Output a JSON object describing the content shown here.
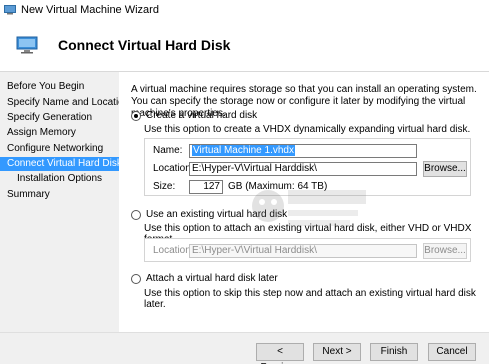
{
  "window": {
    "title": "New Virtual Machine Wizard"
  },
  "header": {
    "title": "Connect Virtual Hard Disk"
  },
  "sidebar": {
    "items": [
      {
        "label": "Before You Begin"
      },
      {
        "label": "Specify Name and Location"
      },
      {
        "label": "Specify Generation"
      },
      {
        "label": "Assign Memory"
      },
      {
        "label": "Configure Networking"
      },
      {
        "label": "Connect Virtual Hard Disk"
      },
      {
        "label": "Installation Options"
      },
      {
        "label": "Summary"
      }
    ]
  },
  "main": {
    "intro": "A virtual machine requires storage so that you can install an operating system. You can specify the storage now or configure it later by modifying the virtual machine's properties.",
    "create": {
      "radio_label": "Create a virtual hard disk",
      "description": "Use this option to create a VHDX dynamically expanding virtual hard disk.",
      "name_label": "Name:",
      "name_value": "Virtual Machine 1.vhdx",
      "location_label": "Location:",
      "location_value": "E:\\Hyper-V\\Virtual Harddisk\\",
      "browse_label": "Browse...",
      "size_label": "Size:",
      "size_value": "127",
      "size_unit": "GB (Maximum: 64 TB)"
    },
    "existing": {
      "radio_label": "Use an existing virtual hard disk",
      "description": "Use this option to attach an existing virtual hard disk, either VHD or VHDX format.",
      "location_label": "Location:",
      "location_value": "E:\\Hyper-V\\Virtual Harddisk\\",
      "browse_label": "Browse..."
    },
    "later": {
      "radio_label": "Attach a virtual hard disk later",
      "description": "Use this option to skip this step now and attach an existing virtual hard disk later."
    }
  },
  "footer": {
    "previous_label": "< Previous",
    "next_label": "Next >",
    "finish_label": "Finish",
    "cancel_label": "Cancel"
  },
  "colors": {
    "selection": "#3399ff",
    "window_bg": "#f0f0f0"
  }
}
